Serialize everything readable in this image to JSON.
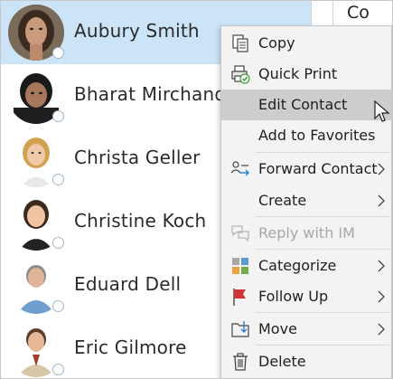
{
  "header": {
    "right_pane_text": "Co"
  },
  "contacts": [
    {
      "name": "Aubury Smith",
      "selected": true
    },
    {
      "name": "Bharat Mirchandani"
    },
    {
      "name": "Christa Geller"
    },
    {
      "name": "Christine Koch"
    },
    {
      "name": "Eduard Dell"
    },
    {
      "name": "Eric Gilmore"
    }
  ],
  "menu": {
    "items": [
      {
        "label": "Copy",
        "icon": "copy-icon"
      },
      {
        "label": "Quick Print",
        "icon": "quick-print-icon"
      },
      {
        "label": "Edit Contact",
        "icon": ""
      },
      {
        "label": "Add to Favorites",
        "icon": ""
      },
      {
        "label": "Forward Contact",
        "icon": "forward-contact-icon",
        "submenu": true
      },
      {
        "label": "Create",
        "icon": "",
        "submenu": true
      },
      {
        "label": "Reply with IM",
        "icon": "reply-im-icon",
        "disabled": true
      },
      {
        "label": "Categorize",
        "icon": "categorize-icon",
        "submenu": true
      },
      {
        "label": "Follow Up",
        "icon": "flag-icon",
        "submenu": true
      },
      {
        "label": "Move",
        "icon": "move-icon",
        "submenu": true
      },
      {
        "label": "Delete",
        "icon": "trash-icon"
      }
    ]
  },
  "colors": {
    "selection": "#cce4f7",
    "menu_bg": "#f3f3f3",
    "menu_hover": "#cdcdcd",
    "categorize": [
      "#e8a33b",
      "#5b9bd5",
      "#70ad47",
      "#a9a9a9"
    ],
    "flag": "#d13438",
    "forward_arrow": "#2b7cd3"
  }
}
